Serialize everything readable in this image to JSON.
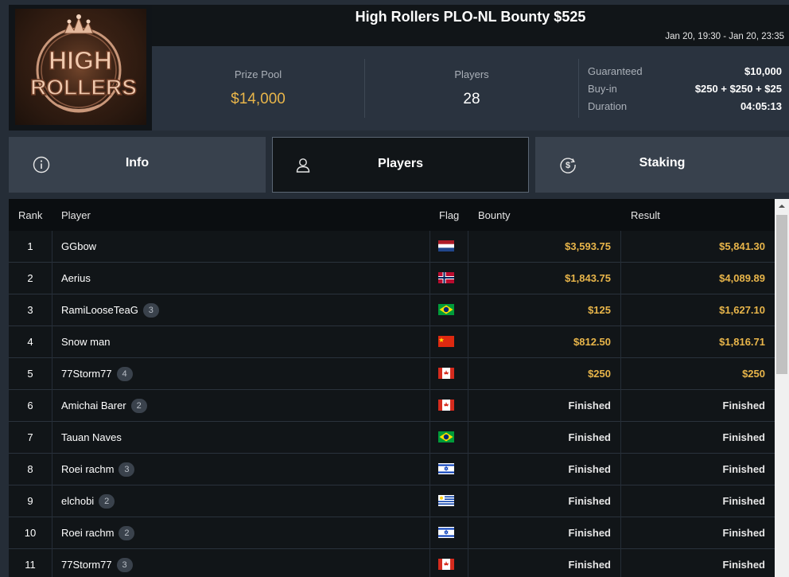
{
  "logo": {
    "line1": "HIGH",
    "line2": "ROLLERS"
  },
  "header": {
    "title": "High Rollers PLO-NL Bounty $525",
    "dates": "Jan 20, 19:30 - Jan 20, 23:35"
  },
  "stats": {
    "prize_pool_label": "Prize Pool",
    "prize_pool_value": "$14,000",
    "players_label": "Players",
    "players_value": "28",
    "guaranteed_label": "Guaranteed",
    "guaranteed_value": "$10,000",
    "buyin_label": "Buy-in",
    "buyin_value": "$250 + $250 + $25",
    "duration_label": "Duration",
    "duration_value": "04:05:13"
  },
  "tabs": [
    {
      "label": "Info",
      "icon": "info-icon"
    },
    {
      "label": "Players",
      "icon": "user-icon"
    },
    {
      "label": "Staking",
      "icon": "dollar-coin-icon"
    }
  ],
  "table": {
    "columns": [
      "Rank",
      "Player",
      "Flag",
      "Bounty",
      "Result"
    ],
    "rows": [
      {
        "rank": "1",
        "player": "GGbow",
        "badge": "",
        "flag": "netherlands",
        "bounty": "$3,593.75",
        "result": "$5,841.30"
      },
      {
        "rank": "2",
        "player": "Aerius",
        "badge": "",
        "flag": "norway",
        "bounty": "$1,843.75",
        "result": "$4,089.89"
      },
      {
        "rank": "3",
        "player": "RamiLooseTeaG",
        "badge": "3",
        "flag": "brazil",
        "bounty": "$125",
        "result": "$1,627.10"
      },
      {
        "rank": "4",
        "player": "Snow man",
        "badge": "",
        "flag": "china",
        "bounty": "$812.50",
        "result": "$1,816.71"
      },
      {
        "rank": "5",
        "player": "77Storm77",
        "badge": "4",
        "flag": "canada",
        "bounty": "$250",
        "result": "$250"
      },
      {
        "rank": "6",
        "player": "Amichai Barer",
        "badge": "2",
        "flag": "canada",
        "bounty": "Finished",
        "result": "Finished"
      },
      {
        "rank": "7",
        "player": "Tauan Naves",
        "badge": "",
        "flag": "brazil",
        "bounty": "Finished",
        "result": "Finished"
      },
      {
        "rank": "8",
        "player": "Roei rachm",
        "badge": "3",
        "flag": "israel",
        "bounty": "Finished",
        "result": "Finished"
      },
      {
        "rank": "9",
        "player": "elchobi",
        "badge": "2",
        "flag": "uruguay",
        "bounty": "Finished",
        "result": "Finished"
      },
      {
        "rank": "10",
        "player": "Roei rachm",
        "badge": "2",
        "flag": "israel",
        "bounty": "Finished",
        "result": "Finished"
      },
      {
        "rank": "11",
        "player": "77Storm77",
        "badge": "3",
        "flag": "canada",
        "bounty": "Finished",
        "result": "Finished"
      }
    ]
  },
  "colors": {
    "gold": "#e8b54a",
    "row_bg": "#111518",
    "header_bg": "#0b0e11",
    "tab_bg": "#38414d"
  }
}
